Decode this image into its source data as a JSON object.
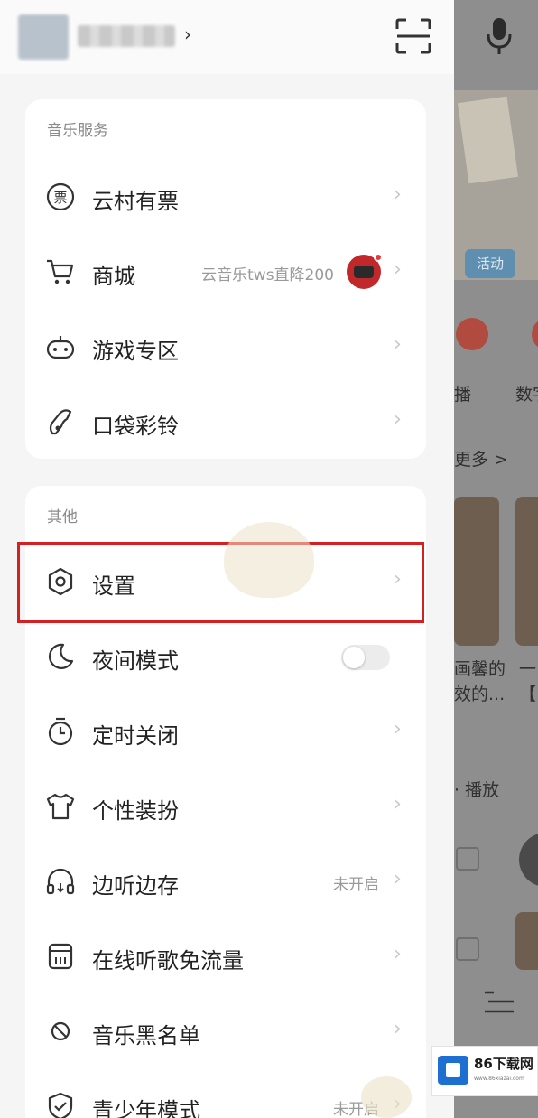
{
  "header": {
    "user_chevron": "›"
  },
  "music_services": {
    "title": "音乐服务",
    "items": [
      {
        "label": "云村有票",
        "icon": "ticket-icon"
      },
      {
        "label": "商城",
        "icon": "cart-icon",
        "extra": "云音乐tws直降200"
      },
      {
        "label": "游戏专区",
        "icon": "gamepad-icon"
      },
      {
        "label": "口袋彩铃",
        "icon": "ringtone-icon"
      }
    ]
  },
  "other": {
    "title": "其他",
    "items": [
      {
        "label": "设置",
        "icon": "settings-icon"
      },
      {
        "label": "夜间模式",
        "icon": "moon-icon",
        "toggle": false
      },
      {
        "label": "定时关闭",
        "icon": "timer-icon"
      },
      {
        "label": "个性装扮",
        "icon": "tshirt-icon"
      },
      {
        "label": "边听边存",
        "icon": "headphones-icon",
        "extra": "未开启"
      },
      {
        "label": "在线听歌免流量",
        "icon": "sim-card-icon"
      },
      {
        "label": "音乐黑名单",
        "icon": "block-icon"
      },
      {
        "label": "青少年模式",
        "icon": "shield-check-icon",
        "extra": "未开启"
      }
    ]
  },
  "arrow": "›",
  "background": {
    "tag": "活动",
    "label_1": "播",
    "label_2": "数字",
    "more": "更多 >",
    "card_text_1": "画馨的",
    "card_text_2": "效的...",
    "card_text_3": "一",
    "card_text_4": "【",
    "play_label": "· 播放"
  },
  "watermark": {
    "title": "86下载网",
    "sub": "www.86xiazai.com"
  },
  "colors": {
    "highlight": "#d42020",
    "drawer_bg": "#f5f5f5"
  }
}
